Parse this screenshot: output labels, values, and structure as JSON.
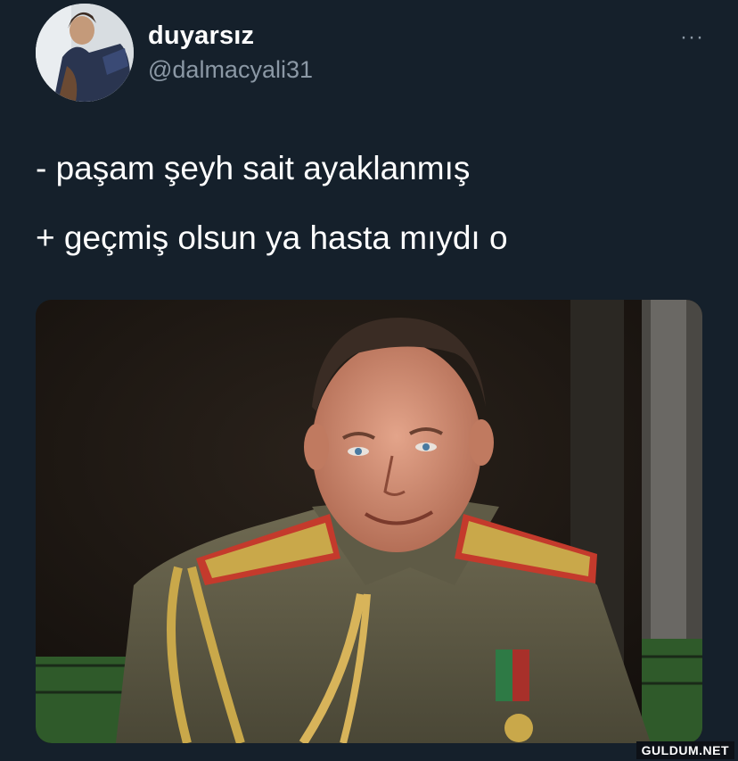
{
  "tweet": {
    "display_name": "duyarsız",
    "handle": "@dalmacyali31",
    "more_icon": "···",
    "lines": [
      "- paşam şeyh sait ayaklanmış",
      "+ geçmiş olsun ya hasta mıydı o"
    ]
  },
  "watermark": "GULDUM.NET",
  "colors": {
    "background": "#15202b",
    "text": "#ffffff",
    "secondary": "#8b98a5"
  }
}
